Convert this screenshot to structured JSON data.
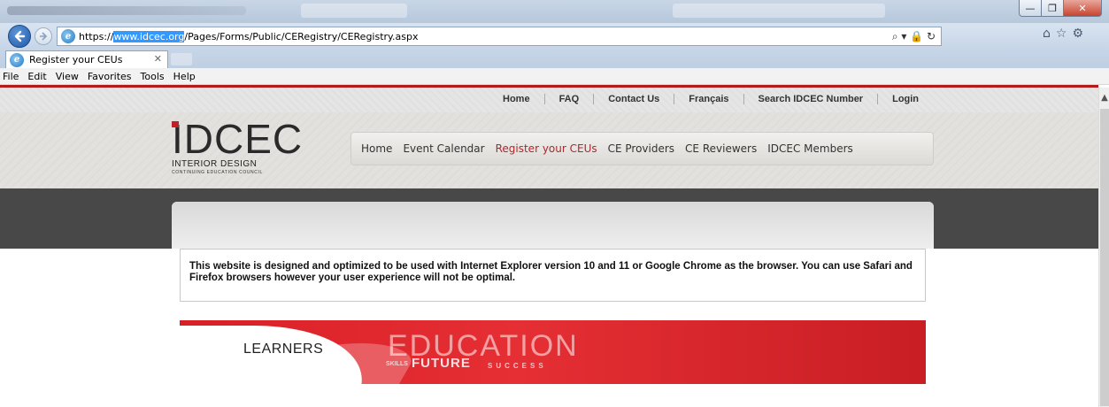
{
  "browser": {
    "window_controls": {
      "minimize": "—",
      "maximize": "❐",
      "close": "✕"
    },
    "url_highlighted": "www.idcec.org",
    "url_prefix": "https://",
    "url_suffix": "/Pages/Forms/Public/CERegistry/CERegistry.aspx",
    "url_tools": "⌕ ▾ 🔒 ↻",
    "tab_title": "Register your CEUs",
    "tab_close": "✕",
    "menu": [
      "File",
      "Edit",
      "View",
      "Favorites",
      "Tools",
      "Help"
    ],
    "accent_color": "#b31b1b"
  },
  "site": {
    "top_links": [
      "Home",
      "FAQ",
      "Contact Us",
      "Français",
      "Search IDCEC Number",
      "Login"
    ],
    "logo": {
      "mark": "IDCEC",
      "line1": "INTERIOR DESIGN",
      "line2": "CONTINUING EDUCATION COUNCIL"
    },
    "main_nav": [
      {
        "label": "Home",
        "active": false
      },
      {
        "label": "Event Calendar",
        "active": false
      },
      {
        "label": "Register your CEUs",
        "active": true
      },
      {
        "label": "CE Providers",
        "active": false
      },
      {
        "label": "CE Reviewers",
        "active": false
      },
      {
        "label": "IDCEC Members",
        "active": false
      }
    ],
    "notice": "This website is designed and optimized to be used with Internet Explorer version 10 and 11 or Google Chrome as the browser. You can use Safari and Firefox browsers however your user experience will not be optimal.",
    "banner": {
      "learners": "LEARNERS",
      "education": "EDUCATION",
      "skills": "SKILLS",
      "future": "FUTURE",
      "success": "SUCCESS"
    },
    "brand_red": "#c22026"
  }
}
